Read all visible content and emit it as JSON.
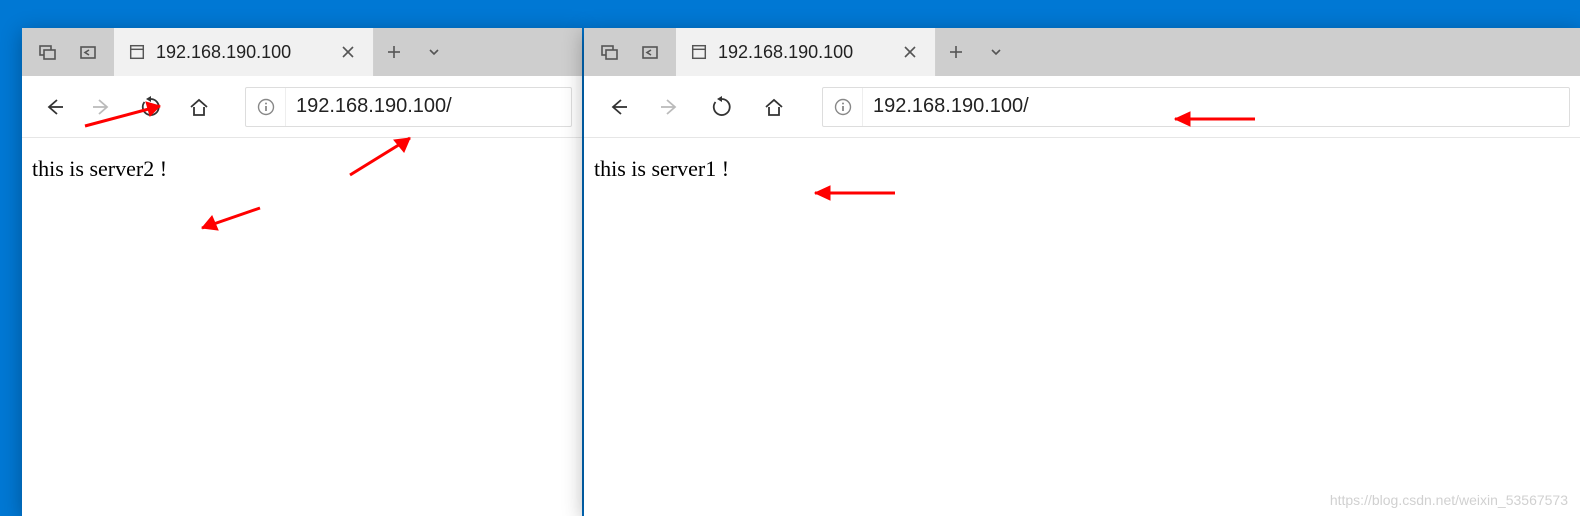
{
  "windows": [
    {
      "id": "left",
      "tab_title": "192.168.190.100",
      "url": "192.168.190.100/",
      "page_text": "this is server2 !"
    },
    {
      "id": "right",
      "tab_title": "192.168.190.100",
      "url": "192.168.190.100/",
      "page_text": "this is server1 !"
    }
  ],
  "watermark": "https://blog.csdn.net/weixin_53567573",
  "annotation_color": "#ff0000"
}
